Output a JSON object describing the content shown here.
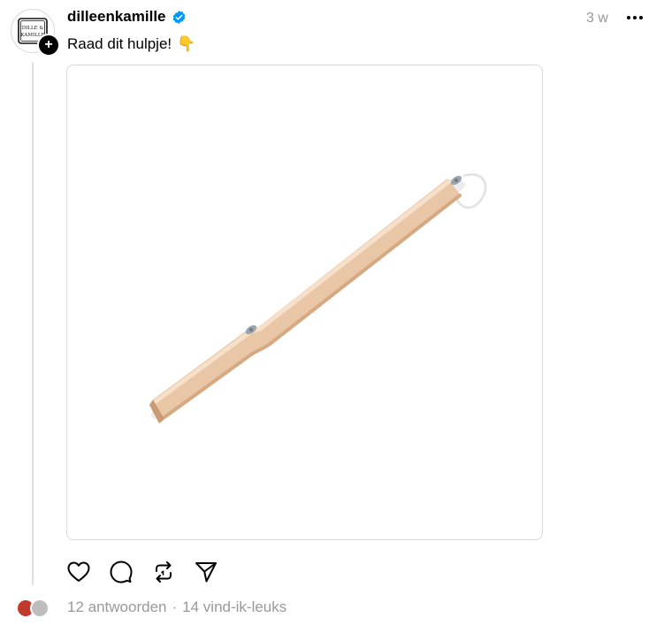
{
  "post": {
    "username": "dilleenkamille",
    "time": "3 w",
    "caption": "Raad dit hulpje!",
    "caption_emoji": "👇",
    "avatar_logo_line1": "DILLE &",
    "avatar_logo_line2": "KAMILLE"
  },
  "stats": {
    "replies": "12 antwoorden",
    "separator": "·",
    "likes": "14 vind-ik-leuks"
  },
  "icons": {
    "verified": "verified-badge-icon",
    "more": "more-dots-icon",
    "like": "heart-icon",
    "reply": "comment-icon",
    "repost": "repost-icon",
    "share": "send-icon"
  },
  "colors": {
    "verified": "#0095f6",
    "muted": "#999999",
    "wood": "#e8c3a0"
  }
}
